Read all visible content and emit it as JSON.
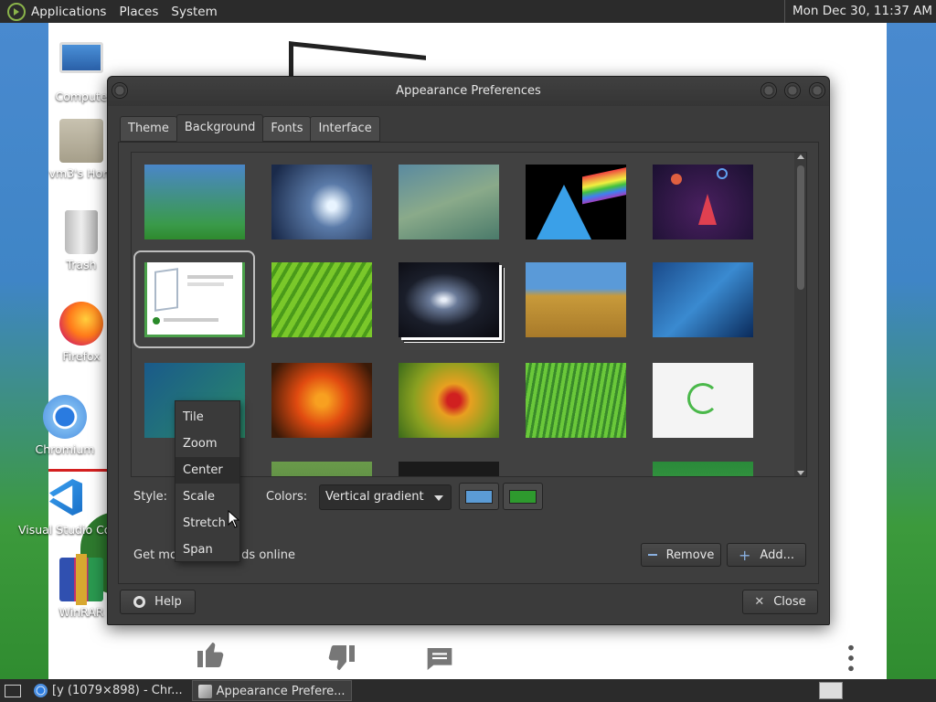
{
  "top_panel": {
    "menus": [
      "Applications",
      "Places",
      "System"
    ],
    "clock": "Mon Dec 30, 11:37 AM"
  },
  "desktop_icons": [
    {
      "name": "computer",
      "label": "Compute",
      "icon": "computer-icon"
    },
    {
      "name": "home",
      "label": "vm3's Hom",
      "icon": "home-folder-icon"
    },
    {
      "name": "trash",
      "label": "Trash",
      "icon": "trash-icon"
    },
    {
      "name": "firefox",
      "label": "Firefox",
      "icon": "firefox-icon"
    },
    {
      "name": "chromium",
      "label": "Chromium",
      "icon": "chromium-icon"
    },
    {
      "name": "vscode",
      "label": "Visual Studio Co",
      "icon": "vscode-icon"
    },
    {
      "name": "winrar",
      "label": "WinRAR",
      "icon": "winrar-icon"
    }
  ],
  "window": {
    "title": "Appearance Preferences",
    "tabs": [
      "Theme",
      "Background",
      "Fonts",
      "Interface"
    ],
    "active_tab": "Background",
    "style_label": "Style:",
    "colors_label": "Colors:",
    "colors_value": "Vertical gradient",
    "primary_color": "#5b9bd5",
    "secondary_color": "#2e9a2e",
    "get_more_text": "Get mo",
    "get_more_tail": "nds online",
    "remove_label": "Remove",
    "add_label": "Add...",
    "help_label": "Help",
    "close_label": "Close"
  },
  "style_options": [
    "Tile",
    "Zoom",
    "Center",
    "Scale",
    "Stretch",
    "Span"
  ],
  "style_selected": "Center",
  "taskbar": {
    "items": [
      "[y (1079×898) - Chr...",
      "Appearance Prefere..."
    ],
    "active": "Appearance Prefere..."
  },
  "colors": {
    "panel": "#2b2b2b",
    "window": "#3b3b3b"
  }
}
